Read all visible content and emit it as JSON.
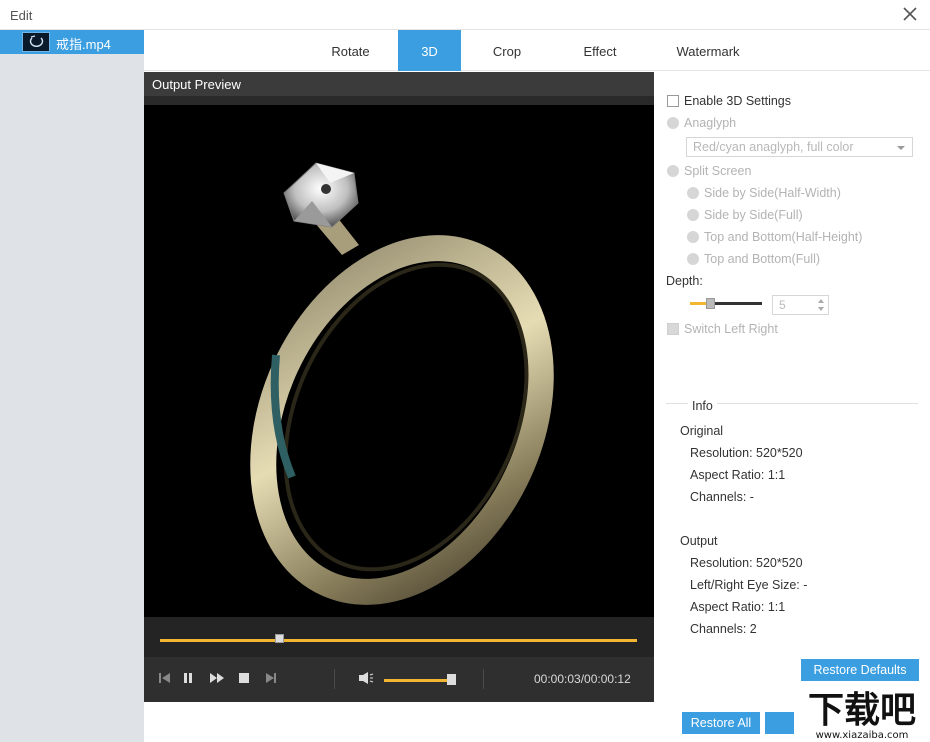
{
  "window": {
    "title": "Edit"
  },
  "files": [
    {
      "name": "戒指.mp4"
    }
  ],
  "tabs": [
    {
      "label": "Rotate"
    },
    {
      "label": "3D"
    },
    {
      "label": "Crop"
    },
    {
      "label": "Effect"
    },
    {
      "label": "Watermark"
    }
  ],
  "active_tab": "3D",
  "preview": {
    "header": "Output Preview",
    "seek_progress": 0.25,
    "volume_level": 0.95,
    "timecode": "00:00:03/00:00:12"
  },
  "settings": {
    "enable_3d_label": "Enable 3D Settings",
    "enable_3d_checked": false,
    "anaglyph_label": "Anaglyph",
    "anaglyph_option": "Red/cyan anaglyph, full color",
    "split_screen_label": "Split Screen",
    "split_options": [
      "Side by Side(Half-Width)",
      "Side by Side(Full)",
      "Top and Bottom(Half-Height)",
      "Top and Bottom(Full)"
    ],
    "depth_label": "Depth:",
    "depth_value": "5",
    "switch_label": "Switch Left Right"
  },
  "info": {
    "title": "Info",
    "original_title": "Original",
    "original": {
      "resolution": "Resolution: 520*520",
      "aspect": "Aspect Ratio: 1:1",
      "channels": "Channels: -"
    },
    "output_title": "Output",
    "output": {
      "resolution": "Resolution: 520*520",
      "eye_size": "Left/Right Eye Size: -",
      "aspect": "Aspect Ratio: 1:1",
      "channels": "Channels: 2"
    }
  },
  "buttons": {
    "restore_defaults": "Restore Defaults",
    "restore_all": "Restore All"
  },
  "watermark_logo": {
    "text": "下载吧",
    "url_text": "www.xiazaiba.com"
  },
  "colors": {
    "accent": "#3a9ee0",
    "progress": "#f2b632",
    "sidebar": "#dfe3e8"
  }
}
